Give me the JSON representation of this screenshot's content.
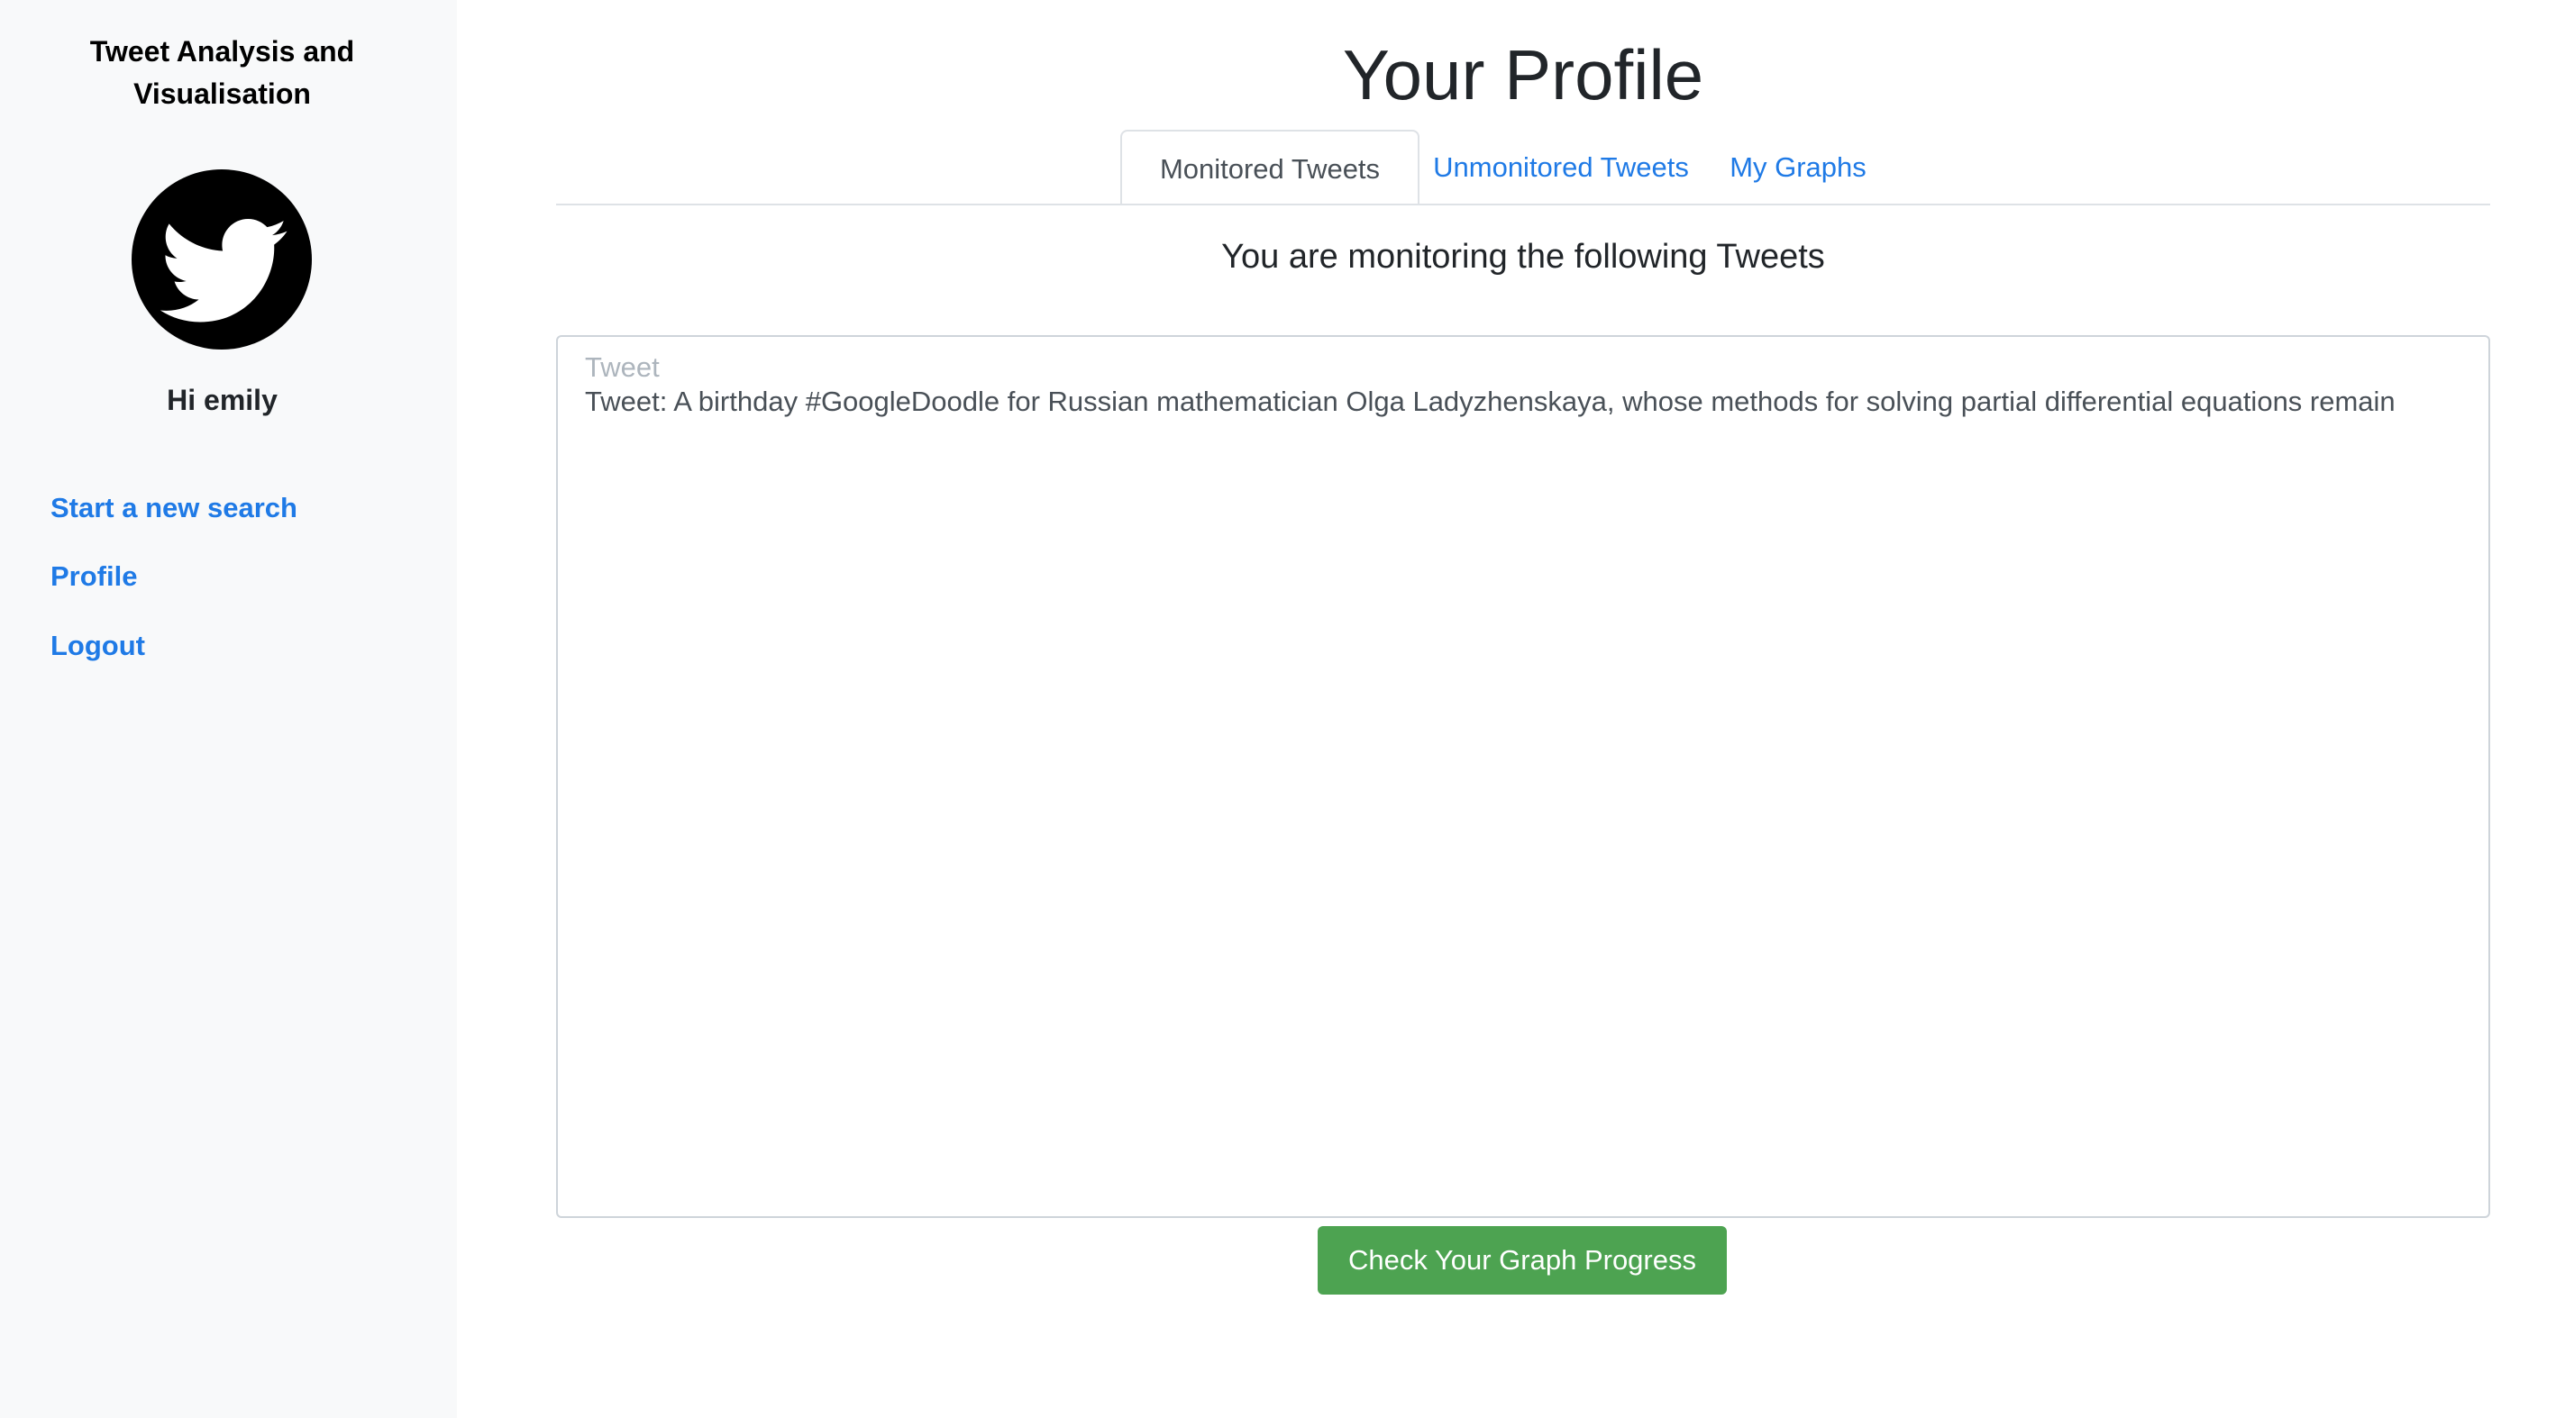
{
  "sidebar": {
    "app_title": "Tweet Analysis and Visualisation",
    "avatar_icon": "twitter-bird-icon",
    "greeting": "Hi emily",
    "links": [
      {
        "label": "Start a new search"
      },
      {
        "label": "Profile"
      },
      {
        "label": "Logout"
      }
    ]
  },
  "main": {
    "title": "Your Profile",
    "tabs": [
      {
        "label": "Monitored Tweets",
        "active": true
      },
      {
        "label": "Unmonitored Tweets",
        "active": false
      },
      {
        "label": "My Graphs",
        "active": false
      }
    ],
    "subheading": "You are monitoring the following Tweets",
    "tweet_list": {
      "label": "Tweet",
      "items": [
        "Tweet: A birthday #GoogleDoodle for Russian mathematician Olga Ladyzhenskaya, whose methods for solving partial differential equations remain"
      ]
    },
    "check_button": "Check Your Graph Progress"
  },
  "colors": {
    "link": "#1f7ae6",
    "sidebar_bg": "#f8f9fa",
    "button_green": "#4da351"
  }
}
